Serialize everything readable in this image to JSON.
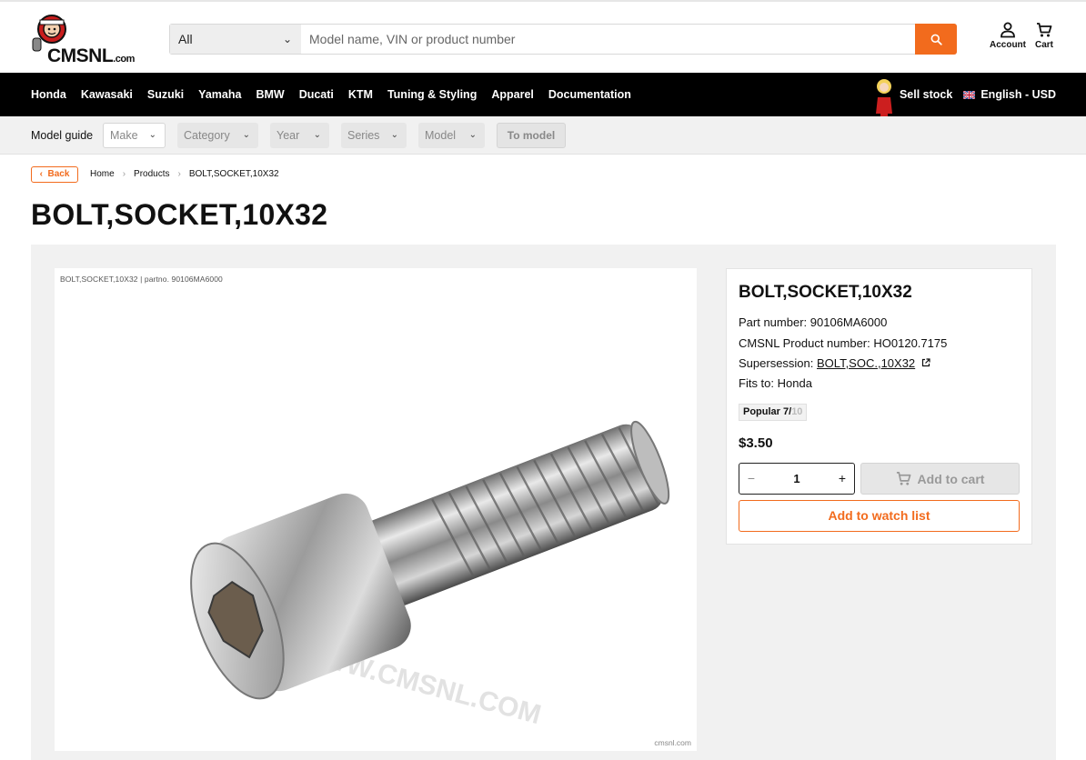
{
  "header": {
    "logo_text": "CMSNL",
    "logo_suffix": ".com",
    "search_category": "All",
    "search_placeholder": "Model name, VIN or product number",
    "account_label": "Account",
    "cart_label": "Cart"
  },
  "nav": {
    "items": [
      "Honda",
      "Kawasaki",
      "Suzuki",
      "Yamaha",
      "BMW",
      "Ducati",
      "KTM",
      "Tuning & Styling",
      "Apparel",
      "Documentation"
    ],
    "sell_stock": "Sell stock",
    "language": "English - USD"
  },
  "model_guide": {
    "label": "Model guide",
    "selects": [
      "Make",
      "Category",
      "Year",
      "Series",
      "Model"
    ],
    "button": "To model"
  },
  "breadcrumb": {
    "back": "Back",
    "items": [
      "Home",
      "Products",
      "BOLT,SOCKET,10X32"
    ]
  },
  "product": {
    "page_title": "BOLT,SOCKET,10X32",
    "image_caption": "BOLT,SOCKET,10X32 | partno. 90106MA6000",
    "image_credit": "cmsnl.com",
    "watermark": "WWW.CMSNL.COM",
    "card_title": "BOLT,SOCKET,10X32",
    "part_number_label": "Part number:",
    "part_number": "90106MA6000",
    "cmsnl_number_label": "CMSNL Product number:",
    "cmsnl_number": "HO0120.7175",
    "supersession_label": "Supersession:",
    "supersession_link": "BOLT,SOC.,10X32",
    "fits_label": "Fits to:",
    "fits": "Honda",
    "popular_label": "Popular 7/",
    "popular_max": "10",
    "price": "$3.50",
    "quantity": "1",
    "qty_minus": "−",
    "qty_plus": "+",
    "add_to_cart": "Add to cart",
    "add_to_watch": "Add to watch list"
  },
  "colors": {
    "accent": "#f26b1d",
    "nav_bg": "#000000",
    "panel_bg": "#f1f1f1"
  },
  "icons": [
    "search-icon",
    "account-icon",
    "cart-icon",
    "chevron-down-icon",
    "uk-flag-icon",
    "external-link-icon"
  ]
}
